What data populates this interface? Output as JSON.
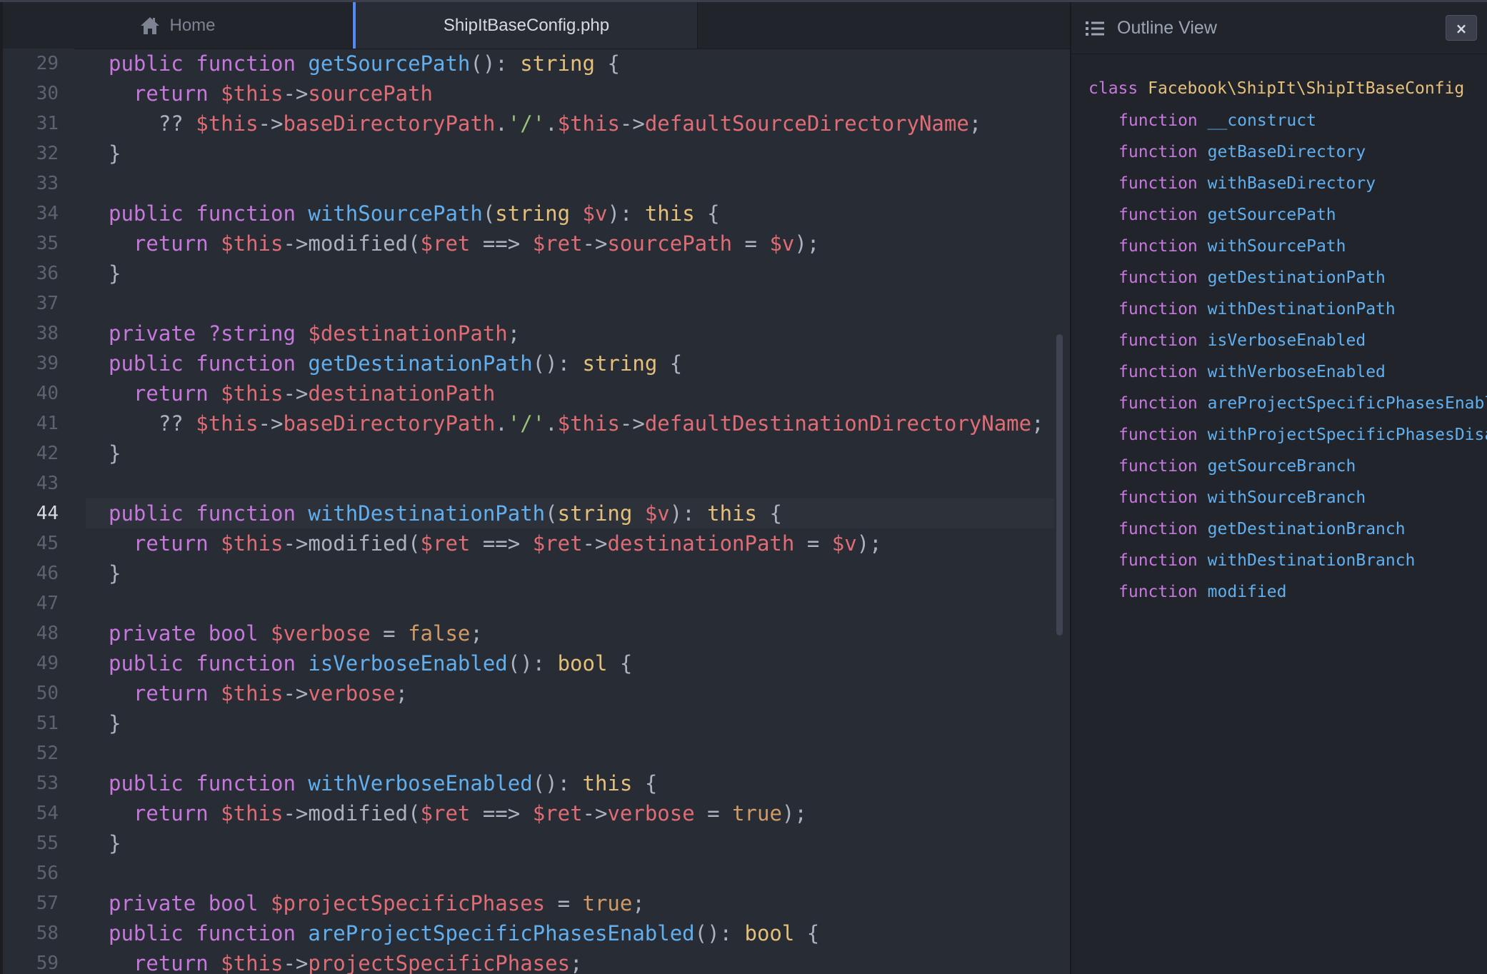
{
  "colors": {
    "background": "#282c34",
    "panel": "#21252b",
    "keyword": "#c678dd",
    "function_name": "#61afef",
    "type": "#e5c07b",
    "variable": "#e06c75",
    "string": "#98c379",
    "boolean": "#d19a66",
    "plain": "#abb2bf",
    "gutter": "#5c6370",
    "tab_accent": "#568af2"
  },
  "tabs": [
    {
      "label": "Home",
      "icon": "home-icon",
      "active": false
    },
    {
      "label": "ShipItBaseConfig.php",
      "active": true
    }
  ],
  "editor": {
    "current_line": 44,
    "lines": [
      {
        "num": "29",
        "indent": "",
        "tokens": [
          [
            "kw",
            "public"
          ],
          [
            "p",
            " "
          ],
          [
            "kw",
            "function"
          ],
          [
            "p",
            " "
          ],
          [
            "fn",
            "getSourcePath"
          ],
          [
            "p",
            "(): "
          ],
          [
            "ty",
            "string"
          ],
          [
            "p",
            " {"
          ]
        ]
      },
      {
        "num": "30",
        "indent": "  ",
        "tokens": [
          [
            "kw",
            "return"
          ],
          [
            "p",
            " "
          ],
          [
            "var",
            "$this"
          ],
          [
            "p",
            "->"
          ],
          [
            "prop",
            "sourcePath"
          ]
        ]
      },
      {
        "num": "31",
        "indent": "    ",
        "tokens": [
          [
            "p",
            "?? "
          ],
          [
            "var",
            "$this"
          ],
          [
            "p",
            "->"
          ],
          [
            "prop",
            "baseDirectoryPath"
          ],
          [
            "p",
            "."
          ],
          [
            "str",
            "'/'"
          ],
          [
            "p",
            "."
          ],
          [
            "var",
            "$this"
          ],
          [
            "p",
            "->"
          ],
          [
            "prop",
            "defaultSourceDirectoryName"
          ],
          [
            "p",
            ";"
          ]
        ]
      },
      {
        "num": "32",
        "indent": "",
        "tokens": [
          [
            "p",
            "}"
          ]
        ]
      },
      {
        "num": "33",
        "indent": "",
        "tokens": []
      },
      {
        "num": "34",
        "indent": "",
        "tokens": [
          [
            "kw",
            "public"
          ],
          [
            "p",
            " "
          ],
          [
            "kw",
            "function"
          ],
          [
            "p",
            " "
          ],
          [
            "fn",
            "withSourcePath"
          ],
          [
            "p",
            "("
          ],
          [
            "ty",
            "string"
          ],
          [
            "p",
            " "
          ],
          [
            "var",
            "$v"
          ],
          [
            "p",
            "): "
          ],
          [
            "ty",
            "this"
          ],
          [
            "p",
            " {"
          ]
        ]
      },
      {
        "num": "35",
        "indent": "  ",
        "tokens": [
          [
            "kw",
            "return"
          ],
          [
            "p",
            " "
          ],
          [
            "var",
            "$this"
          ],
          [
            "p",
            "->modified("
          ],
          [
            "var",
            "$ret"
          ],
          [
            "p",
            " ==> "
          ],
          [
            "var",
            "$ret"
          ],
          [
            "p",
            "->"
          ],
          [
            "prop",
            "sourcePath"
          ],
          [
            "p",
            " = "
          ],
          [
            "var",
            "$v"
          ],
          [
            "p",
            ");"
          ]
        ]
      },
      {
        "num": "36",
        "indent": "",
        "tokens": [
          [
            "p",
            "}"
          ]
        ]
      },
      {
        "num": "37",
        "indent": "",
        "tokens": []
      },
      {
        "num": "38",
        "indent": "",
        "tokens": [
          [
            "kw",
            "private"
          ],
          [
            "p",
            " "
          ],
          [
            "kw",
            "?string"
          ],
          [
            "p",
            " "
          ],
          [
            "var",
            "$destinationPath"
          ],
          [
            "p",
            ";"
          ]
        ]
      },
      {
        "num": "39",
        "indent": "",
        "tokens": [
          [
            "kw",
            "public"
          ],
          [
            "p",
            " "
          ],
          [
            "kw",
            "function"
          ],
          [
            "p",
            " "
          ],
          [
            "fn",
            "getDestinationPath"
          ],
          [
            "p",
            "(): "
          ],
          [
            "ty",
            "string"
          ],
          [
            "p",
            " {"
          ]
        ]
      },
      {
        "num": "40",
        "indent": "  ",
        "tokens": [
          [
            "kw",
            "return"
          ],
          [
            "p",
            " "
          ],
          [
            "var",
            "$this"
          ],
          [
            "p",
            "->"
          ],
          [
            "prop",
            "destinationPath"
          ]
        ]
      },
      {
        "num": "41",
        "indent": "    ",
        "tokens": [
          [
            "p",
            "?? "
          ],
          [
            "var",
            "$this"
          ],
          [
            "p",
            "->"
          ],
          [
            "prop",
            "baseDirectoryPath"
          ],
          [
            "p",
            "."
          ],
          [
            "str",
            "'/'"
          ],
          [
            "p",
            "."
          ],
          [
            "var",
            "$this"
          ],
          [
            "p",
            "->"
          ],
          [
            "prop",
            "defaultDestinationDirectoryName"
          ],
          [
            "p",
            ";"
          ]
        ]
      },
      {
        "num": "42",
        "indent": "",
        "tokens": [
          [
            "p",
            "}"
          ]
        ]
      },
      {
        "num": "43",
        "indent": "",
        "tokens": []
      },
      {
        "num": "44",
        "indent": "",
        "tokens": [
          [
            "kw",
            "public"
          ],
          [
            "p",
            " "
          ],
          [
            "kw",
            "function"
          ],
          [
            "p",
            " "
          ],
          [
            "fn",
            "withDestinationPath"
          ],
          [
            "p",
            "("
          ],
          [
            "ty",
            "string"
          ],
          [
            "p",
            " "
          ],
          [
            "var",
            "$v"
          ],
          [
            "p",
            "): "
          ],
          [
            "ty",
            "this"
          ],
          [
            "p",
            " {"
          ]
        ]
      },
      {
        "num": "45",
        "indent": "  ",
        "tokens": [
          [
            "kw",
            "return"
          ],
          [
            "p",
            " "
          ],
          [
            "var",
            "$this"
          ],
          [
            "p",
            "->modified("
          ],
          [
            "var",
            "$ret"
          ],
          [
            "p",
            " ==> "
          ],
          [
            "var",
            "$ret"
          ],
          [
            "p",
            "->"
          ],
          [
            "prop",
            "destinationPath"
          ],
          [
            "p",
            " = "
          ],
          [
            "var",
            "$v"
          ],
          [
            "p",
            ");"
          ]
        ]
      },
      {
        "num": "46",
        "indent": "",
        "tokens": [
          [
            "p",
            "}"
          ]
        ]
      },
      {
        "num": "47",
        "indent": "",
        "tokens": []
      },
      {
        "num": "48",
        "indent": "",
        "tokens": [
          [
            "kw",
            "private"
          ],
          [
            "p",
            " "
          ],
          [
            "kw",
            "bool"
          ],
          [
            "p",
            " "
          ],
          [
            "var",
            "$verbose"
          ],
          [
            "p",
            " = "
          ],
          [
            "bool",
            "false"
          ],
          [
            "p",
            ";"
          ]
        ]
      },
      {
        "num": "49",
        "indent": "",
        "tokens": [
          [
            "kw",
            "public"
          ],
          [
            "p",
            " "
          ],
          [
            "kw",
            "function"
          ],
          [
            "p",
            " "
          ],
          [
            "fn",
            "isVerboseEnabled"
          ],
          [
            "p",
            "(): "
          ],
          [
            "ty",
            "bool"
          ],
          [
            "p",
            " {"
          ]
        ]
      },
      {
        "num": "50",
        "indent": "  ",
        "tokens": [
          [
            "kw",
            "return"
          ],
          [
            "p",
            " "
          ],
          [
            "var",
            "$this"
          ],
          [
            "p",
            "->"
          ],
          [
            "prop",
            "verbose"
          ],
          [
            "p",
            ";"
          ]
        ]
      },
      {
        "num": "51",
        "indent": "",
        "tokens": [
          [
            "p",
            "}"
          ]
        ]
      },
      {
        "num": "52",
        "indent": "",
        "tokens": []
      },
      {
        "num": "53",
        "indent": "",
        "tokens": [
          [
            "kw",
            "public"
          ],
          [
            "p",
            " "
          ],
          [
            "kw",
            "function"
          ],
          [
            "p",
            " "
          ],
          [
            "fn",
            "withVerboseEnabled"
          ],
          [
            "p",
            "(): "
          ],
          [
            "ty",
            "this"
          ],
          [
            "p",
            " {"
          ]
        ]
      },
      {
        "num": "54",
        "indent": "  ",
        "tokens": [
          [
            "kw",
            "return"
          ],
          [
            "p",
            " "
          ],
          [
            "var",
            "$this"
          ],
          [
            "p",
            "->modified("
          ],
          [
            "var",
            "$ret"
          ],
          [
            "p",
            " ==> "
          ],
          [
            "var",
            "$ret"
          ],
          [
            "p",
            "->"
          ],
          [
            "prop",
            "verbose"
          ],
          [
            "p",
            " = "
          ],
          [
            "bool",
            "true"
          ],
          [
            "p",
            ");"
          ]
        ]
      },
      {
        "num": "55",
        "indent": "",
        "tokens": [
          [
            "p",
            "}"
          ]
        ]
      },
      {
        "num": "56",
        "indent": "",
        "tokens": []
      },
      {
        "num": "57",
        "indent": "",
        "tokens": [
          [
            "kw",
            "private"
          ],
          [
            "p",
            " "
          ],
          [
            "kw",
            "bool"
          ],
          [
            "p",
            " "
          ],
          [
            "var",
            "$projectSpecificPhases"
          ],
          [
            "p",
            " = "
          ],
          [
            "bool",
            "true"
          ],
          [
            "p",
            ";"
          ]
        ]
      },
      {
        "num": "58",
        "indent": "",
        "tokens": [
          [
            "kw",
            "public"
          ],
          [
            "p",
            " "
          ],
          [
            "kw",
            "function"
          ],
          [
            "p",
            " "
          ],
          [
            "fn",
            "areProjectSpecificPhasesEnabled"
          ],
          [
            "p",
            "(): "
          ],
          [
            "ty",
            "bool"
          ],
          [
            "p",
            " {"
          ]
        ]
      },
      {
        "num": "59",
        "indent": "  ",
        "tokens": [
          [
            "kw",
            "return"
          ],
          [
            "p",
            " "
          ],
          [
            "var",
            "$this"
          ],
          [
            "p",
            "->"
          ],
          [
            "prop",
            "projectSpecificPhases"
          ],
          [
            "p",
            ";"
          ]
        ]
      }
    ]
  },
  "outline": {
    "title": "Outline View",
    "title_icon": "list-icon",
    "close_label": "×",
    "class_keyword": "class",
    "class_name": "Facebook\\ShipIt\\ShipItBaseConfig",
    "function_keyword": "function",
    "functions": [
      "__construct",
      "getBaseDirectory",
      "withBaseDirectory",
      "getSourcePath",
      "withSourcePath",
      "getDestinationPath",
      "withDestinationPath",
      "isVerboseEnabled",
      "withVerboseEnabled",
      "areProjectSpecificPhasesEnabled",
      "withProjectSpecificPhasesDisabled",
      "getSourceBranch",
      "withSourceBranch",
      "getDestinationBranch",
      "withDestinationBranch",
      "modified"
    ]
  }
}
